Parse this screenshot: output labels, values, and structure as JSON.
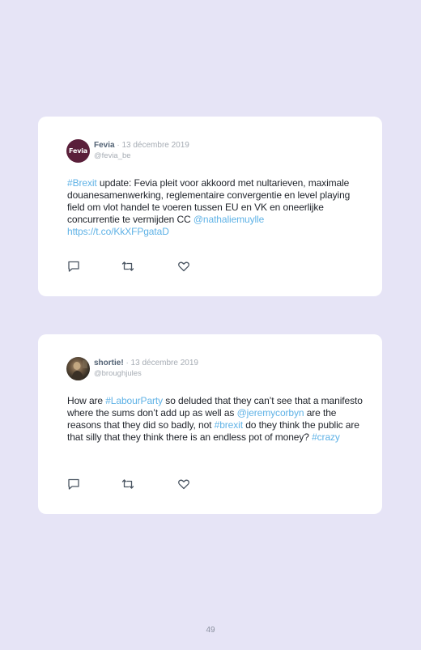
{
  "tweets": [
    {
      "avatar_text": "Fevia",
      "name": "Fevia",
      "date": "· 13 décembre 2019",
      "handle": "@fevia_be",
      "text": {
        "hashtag1": "#Brexit",
        "body1": " update: Fevia pleit voor akkoord met nultarieven, maximale douanesamenwerking, reglementaire convergentie en level playing field om vlot handel te voeren tussen EU en VK en oneerlijke concurrentie te vermijden CC ",
        "mention1": "@nathaliemuylle",
        "space": " ",
        "url1": "https://t.co/KkXFPgataD"
      },
      "icons": [
        "reply-icon",
        "retweet-icon",
        "like-icon"
      ]
    },
    {
      "name": "shortie!",
      "date": "· 13 décembre 2019",
      "handle": "@broughjules",
      "text": {
        "body1": "How are ",
        "hashtag1": "#LabourParty",
        "body2": " so deluded that they can’t see that a manifesto where the sums don’t add up as well as ",
        "mention1": "@jeremycorbyn",
        "body3": " are the reasons that they did so badly, not ",
        "hashtag2": "#brexit",
        "body4": " do they think the public are that silly that they think there is an endless pot of money? ",
        "hashtag3": "#crazy"
      },
      "icons": [
        "reply-icon",
        "retweet-icon",
        "like-icon"
      ]
    }
  ],
  "footer": {
    "page_number": "49"
  },
  "colors": {
    "background": "#e6e4f6",
    "card": "#ffffff",
    "link": "#5fb2e6",
    "name": "#526274",
    "muted": "#a6acb4",
    "fevia_brand": "#5a1f3a"
  }
}
